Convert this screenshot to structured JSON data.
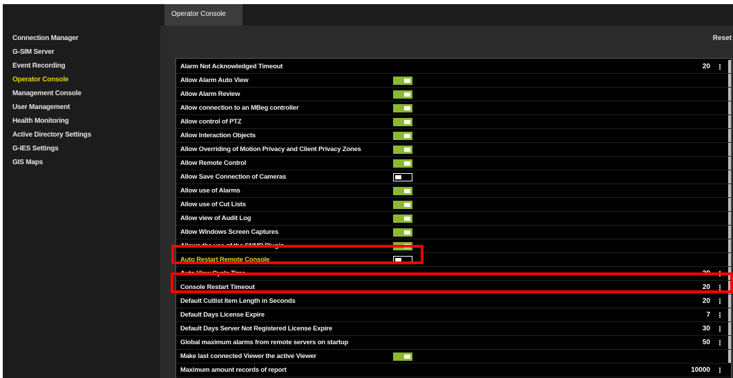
{
  "sidebar": {
    "items": [
      {
        "label": "Connection Manager"
      },
      {
        "label": "G-SIM Server"
      },
      {
        "label": "Event Recording"
      },
      {
        "label": "Operator Console",
        "active": true
      },
      {
        "label": "Management Console"
      },
      {
        "label": "User Management"
      },
      {
        "label": "Health Monitoring"
      },
      {
        "label": "Active Directory Settings"
      },
      {
        "label": "G-IES Settings"
      },
      {
        "label": "GIS Maps"
      }
    ]
  },
  "tab": {
    "label": "Operator Console"
  },
  "reset_label": "Reset",
  "colors": {
    "accent": "#e5d21b",
    "toggle_on": "#8cb833",
    "highlight": "#ff0000"
  },
  "settings": [
    {
      "label": "Alarm Not Acknowledged Timeout",
      "type": "number",
      "value": "20"
    },
    {
      "label": "Allow Alarm Auto View",
      "type": "toggle",
      "value": true
    },
    {
      "label": "Allow Alarm Review",
      "type": "toggle",
      "value": true
    },
    {
      "label": "Allow connection to an MBeg controller",
      "type": "toggle",
      "value": true
    },
    {
      "label": "Allow control of PTZ",
      "type": "toggle",
      "value": true
    },
    {
      "label": "Allow Interaction Objects",
      "type": "toggle",
      "value": true
    },
    {
      "label": "Allow Overriding of Motion Privacy and Client Privacy Zones",
      "type": "toggle",
      "value": true
    },
    {
      "label": "Allow Remote Control",
      "type": "toggle",
      "value": true
    },
    {
      "label": "Allow Save Connection of Cameras",
      "type": "toggle",
      "value": false
    },
    {
      "label": "Allow use of Alarms",
      "type": "toggle",
      "value": true
    },
    {
      "label": "Allow use of Cut Lists",
      "type": "toggle",
      "value": true
    },
    {
      "label": "Allow view of Audit Log",
      "type": "toggle",
      "value": true
    },
    {
      "label": "Allow Windows Screen Captures",
      "type": "toggle",
      "value": true
    },
    {
      "label": "Allows the use of the SNMP Plugin",
      "type": "toggle",
      "value": true
    },
    {
      "label": "Auto Restart Remote Console",
      "type": "toggle",
      "value": false,
      "highlighted": true
    },
    {
      "label": "Auto View Cycle Time",
      "type": "number",
      "value": "20"
    },
    {
      "label": "Console Restart Timeout",
      "type": "number",
      "value": "20",
      "highlighted": true
    },
    {
      "label": "Default Cutlist Item Length in Seconds",
      "type": "number",
      "value": "20"
    },
    {
      "label": "Default Days License Expire",
      "type": "number",
      "value": "7"
    },
    {
      "label": "Default Days Server Not Registered License Expire",
      "type": "number",
      "value": "30"
    },
    {
      "label": "Global maximum alarms from remote servers on startup",
      "type": "number",
      "value": "50"
    },
    {
      "label": "Make last connected Viewer the active Viewer",
      "type": "toggle",
      "value": true
    },
    {
      "label": "Maximum amount records of report",
      "type": "number",
      "value": "10000"
    }
  ]
}
